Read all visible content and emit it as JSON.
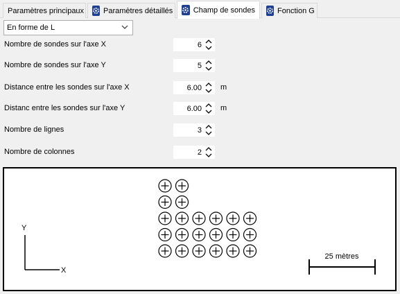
{
  "tabs": [
    {
      "label": "Paramètres principaux",
      "icon": null,
      "active": false
    },
    {
      "label": "Paramètres détaillés",
      "icon": "gear-icon",
      "active": false
    },
    {
      "label": "Champ de sondes",
      "icon": "gear-icon",
      "active": true
    },
    {
      "label": "Fonction G",
      "icon": "gear-icon",
      "active": false
    }
  ],
  "layout_select": {
    "value": "En forme de L"
  },
  "fields": [
    {
      "label": "Nombre de sondes sur l'axe X",
      "value": "6",
      "unit": ""
    },
    {
      "label": "Nombre de sondes sur l'axe Y",
      "value": "5",
      "unit": ""
    },
    {
      "label": "Distance entre les sondes sur l'axe X",
      "value": "6.00",
      "unit": "m"
    },
    {
      "label": "Distanc entre les sondes sur l'axe Y",
      "value": "6.00",
      "unit": "m"
    },
    {
      "label": "Nombre de lignes",
      "value": "3",
      "unit": ""
    },
    {
      "label": "Nombre de colonnes",
      "value": "2",
      "unit": ""
    }
  ],
  "preview": {
    "axis_y_label": "Y",
    "axis_x_label": "X",
    "scale_label": "25 mètres",
    "boreholes_per_row": [
      2,
      2,
      6,
      6,
      6
    ]
  },
  "colors": {
    "tab_icon": "#1f3f8f",
    "canvas_border": "#000000"
  }
}
